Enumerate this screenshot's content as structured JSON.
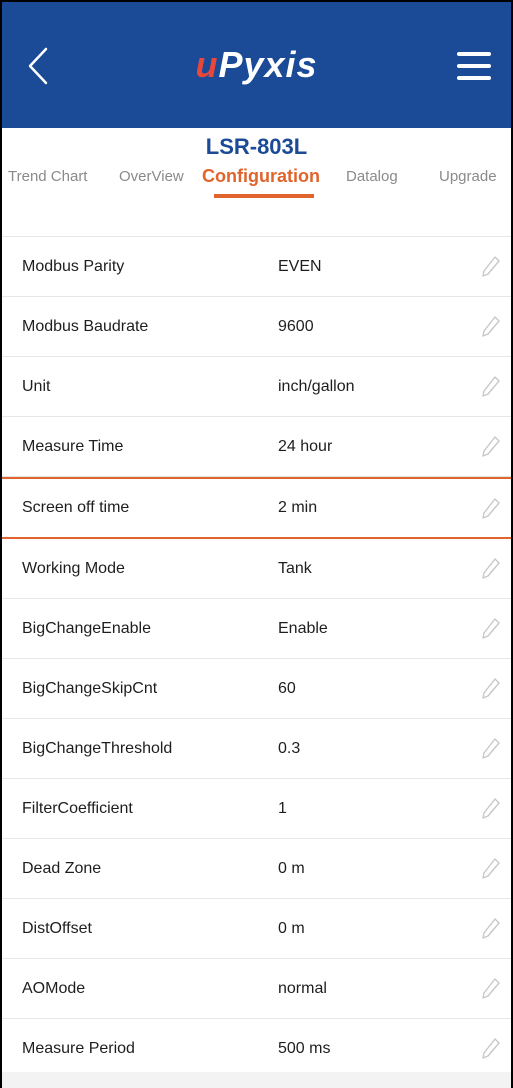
{
  "header": {
    "logo_u": "u",
    "logo_rest": "Pyxis",
    "back_icon": "chevron-left-icon",
    "menu_icon": "hamburger-menu-icon"
  },
  "device": {
    "title": "LSR-803L"
  },
  "tabs": [
    {
      "label": "Trend Chart"
    },
    {
      "label": "OverView"
    },
    {
      "label": "Configuration",
      "active": true
    },
    {
      "label": "Datalog"
    },
    {
      "label": "Upgrade"
    }
  ],
  "colors": {
    "header_bg": "#1b4a97",
    "accent": "#e0642c",
    "logo_u": "#e8483b"
  },
  "config_rows": [
    {
      "label": "Modbus Parity",
      "value": "EVEN"
    },
    {
      "label": "Modbus Baudrate",
      "value": "9600"
    },
    {
      "label": "Unit",
      "value": "inch/gallon"
    },
    {
      "label": "Measure Time",
      "value": "24 hour"
    },
    {
      "label": "Screen off time",
      "value": "2 min",
      "highlighted": true
    },
    {
      "label": "Working Mode",
      "value": "Tank"
    },
    {
      "label": "BigChangeEnable",
      "value": "Enable"
    },
    {
      "label": "BigChangeSkipCnt",
      "value": "60"
    },
    {
      "label": "BigChangeThreshold",
      "value": "0.3"
    },
    {
      "label": "FilterCoefficient",
      "value": "1"
    },
    {
      "label": "Dead Zone",
      "value": "0 m"
    },
    {
      "label": "DistOffset",
      "value": "0 m"
    },
    {
      "label": "AOMode",
      "value": "normal"
    },
    {
      "label": "Measure Period",
      "value": "500 ms"
    }
  ]
}
